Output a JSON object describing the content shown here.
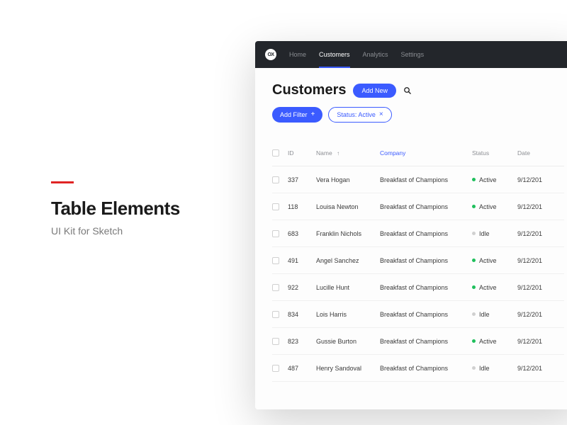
{
  "promo": {
    "title": "Table Elements",
    "subtitle": "UI Kit for Sketch"
  },
  "navbar": {
    "logo": "OX",
    "items": [
      {
        "label": "Home",
        "active": false
      },
      {
        "label": "Customers",
        "active": true
      },
      {
        "label": "Analytics",
        "active": false
      },
      {
        "label": "Settings",
        "active": false
      }
    ]
  },
  "page": {
    "title": "Customers",
    "addNew": "Add New",
    "filters": {
      "addFilter": "Add Filter",
      "statusActive": "Status: Active"
    }
  },
  "table": {
    "headers": {
      "id": "ID",
      "name": "Name",
      "company": "Company",
      "status": "Status",
      "date": "Date"
    },
    "rows": [
      {
        "id": "337",
        "name": "Vera Hogan",
        "company": "Breakfast of Champions",
        "status": "Active",
        "statusKind": "active",
        "date": "9/12/201"
      },
      {
        "id": "118",
        "name": "Louisa Newton",
        "company": "Breakfast of Champions",
        "status": "Active",
        "statusKind": "active",
        "date": "9/12/201"
      },
      {
        "id": "683",
        "name": "Franklin Nichols",
        "company": "Breakfast of Champions",
        "status": "Idle",
        "statusKind": "idle",
        "date": "9/12/201"
      },
      {
        "id": "491",
        "name": "Angel Sanchez",
        "company": "Breakfast of Champions",
        "status": "Active",
        "statusKind": "active",
        "date": "9/12/201"
      },
      {
        "id": "922",
        "name": "Lucille Hunt",
        "company": "Breakfast of Champions",
        "status": "Active",
        "statusKind": "active",
        "date": "9/12/201"
      },
      {
        "id": "834",
        "name": "Lois Harris",
        "company": "Breakfast of Champions",
        "status": "Idle",
        "statusKind": "idle",
        "date": "9/12/201"
      },
      {
        "id": "823",
        "name": "Gussie Burton",
        "company": "Breakfast of Champions",
        "status": "Active",
        "statusKind": "active",
        "date": "9/12/201"
      },
      {
        "id": "487",
        "name": "Henry Sandoval",
        "company": "Breakfast of Champions",
        "status": "Idle",
        "statusKind": "idle",
        "date": "9/12/201"
      }
    ]
  }
}
